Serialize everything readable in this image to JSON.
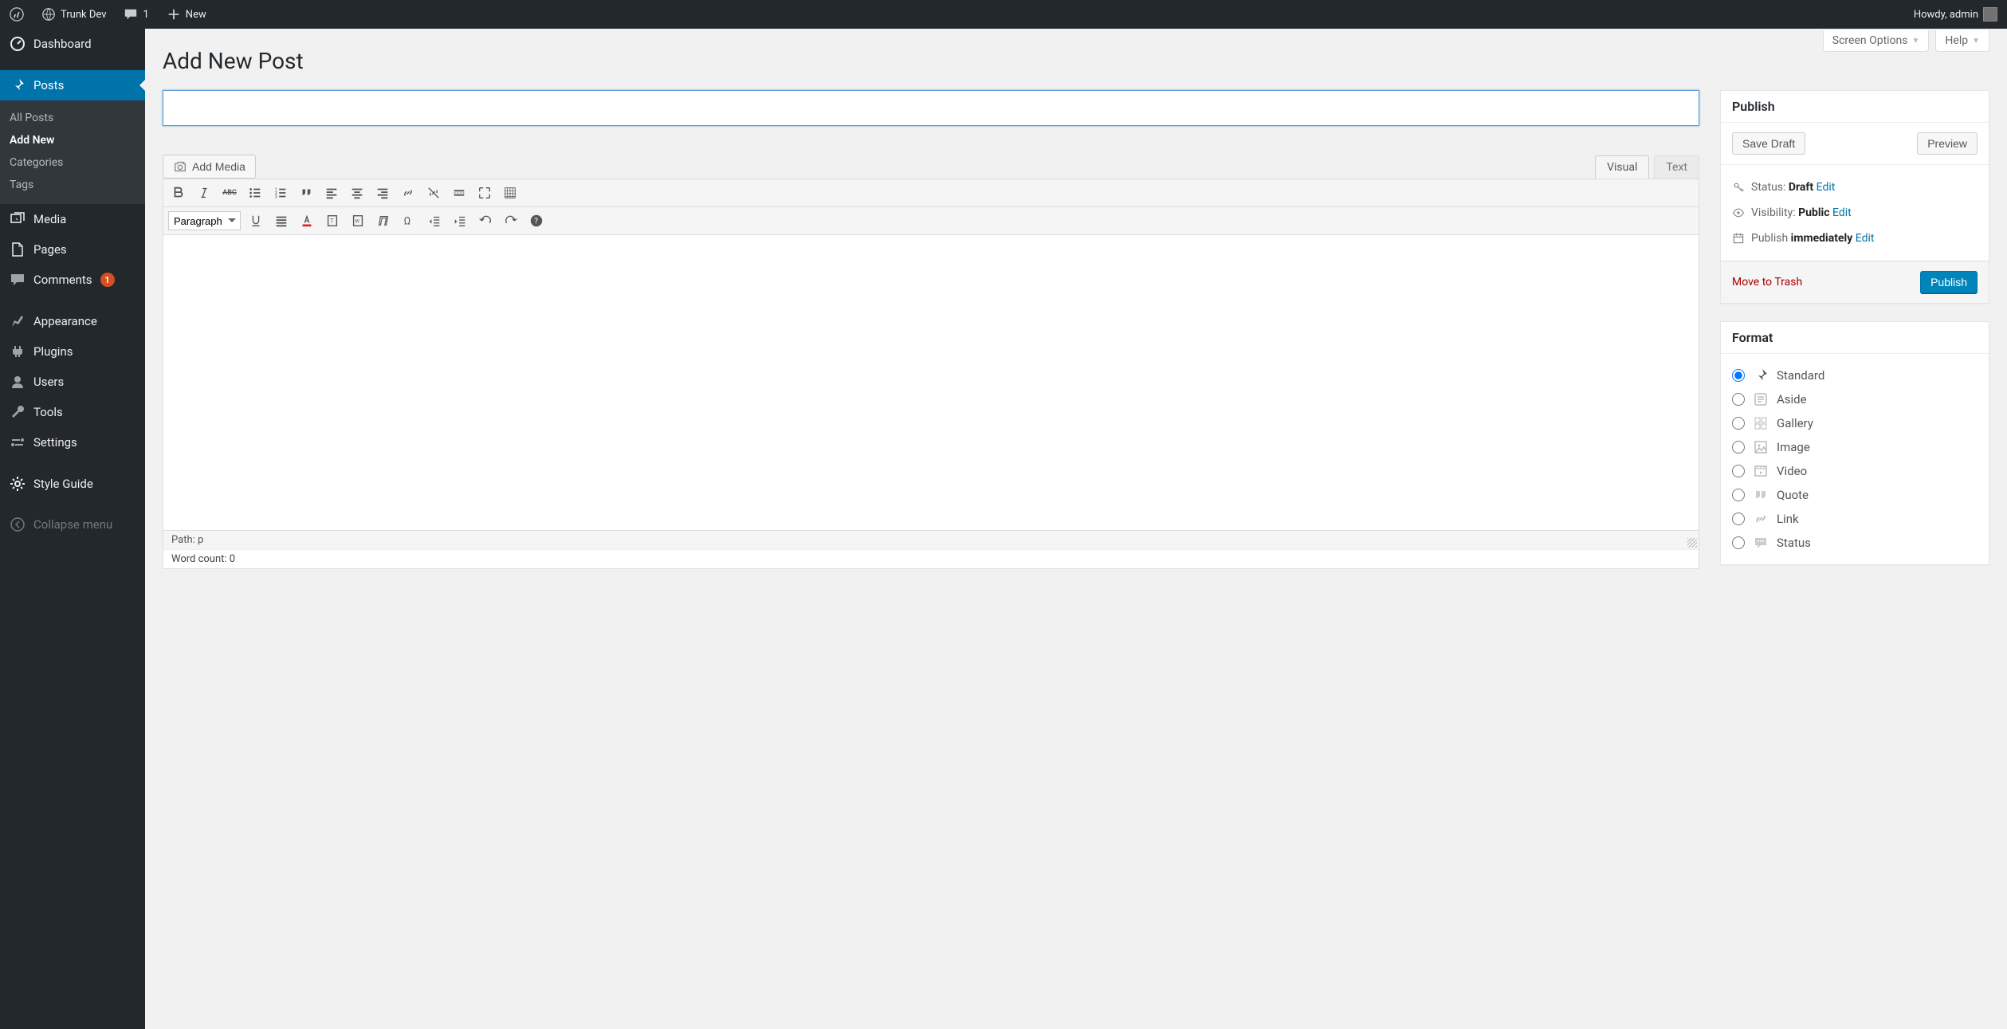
{
  "topbar": {
    "site": "Trunk Dev",
    "comments": "1",
    "new": "New",
    "howdy": "Howdy, admin"
  },
  "sidemenu": {
    "dashboard": "Dashboard",
    "posts": "Posts",
    "media": "Media",
    "pages": "Pages",
    "comments": "Comments",
    "comments_badge": "1",
    "appearance": "Appearance",
    "plugins": "Plugins",
    "users": "Users",
    "tools": "Tools",
    "settings": "Settings",
    "style": "Style Guide",
    "collapse": "Collapse menu"
  },
  "submenu": {
    "all": "All Posts",
    "add": "Add New",
    "cat": "Categories",
    "tags": "Tags"
  },
  "topTabs": {
    "screen": "Screen Options",
    "help": "Help"
  },
  "page": {
    "title": "Add New Post"
  },
  "title": {
    "placeholder": ""
  },
  "media": {
    "add": "Add Media"
  },
  "editorTabs": {
    "visual": "Visual",
    "text": "Text"
  },
  "paragraph": "Paragraph",
  "status": {
    "path_label": "Path:",
    "path": "p",
    "wc_label": "Word count:",
    "wc": "0"
  },
  "publish": {
    "title": "Publish",
    "save": "Save Draft",
    "preview": "Preview",
    "status_label": "Status:",
    "status_value": "Draft",
    "vis_label": "Visibility:",
    "vis_value": "Public",
    "pub_label": "Publish",
    "pub_value": "immediately",
    "edit": "Edit",
    "trash": "Move to Trash",
    "publish": "Publish"
  },
  "format": {
    "title": "Format",
    "standard": "Standard",
    "aside": "Aside",
    "gallery": "Gallery",
    "image": "Image",
    "video": "Video",
    "quote": "Quote",
    "link": "Link",
    "status": "Status"
  }
}
